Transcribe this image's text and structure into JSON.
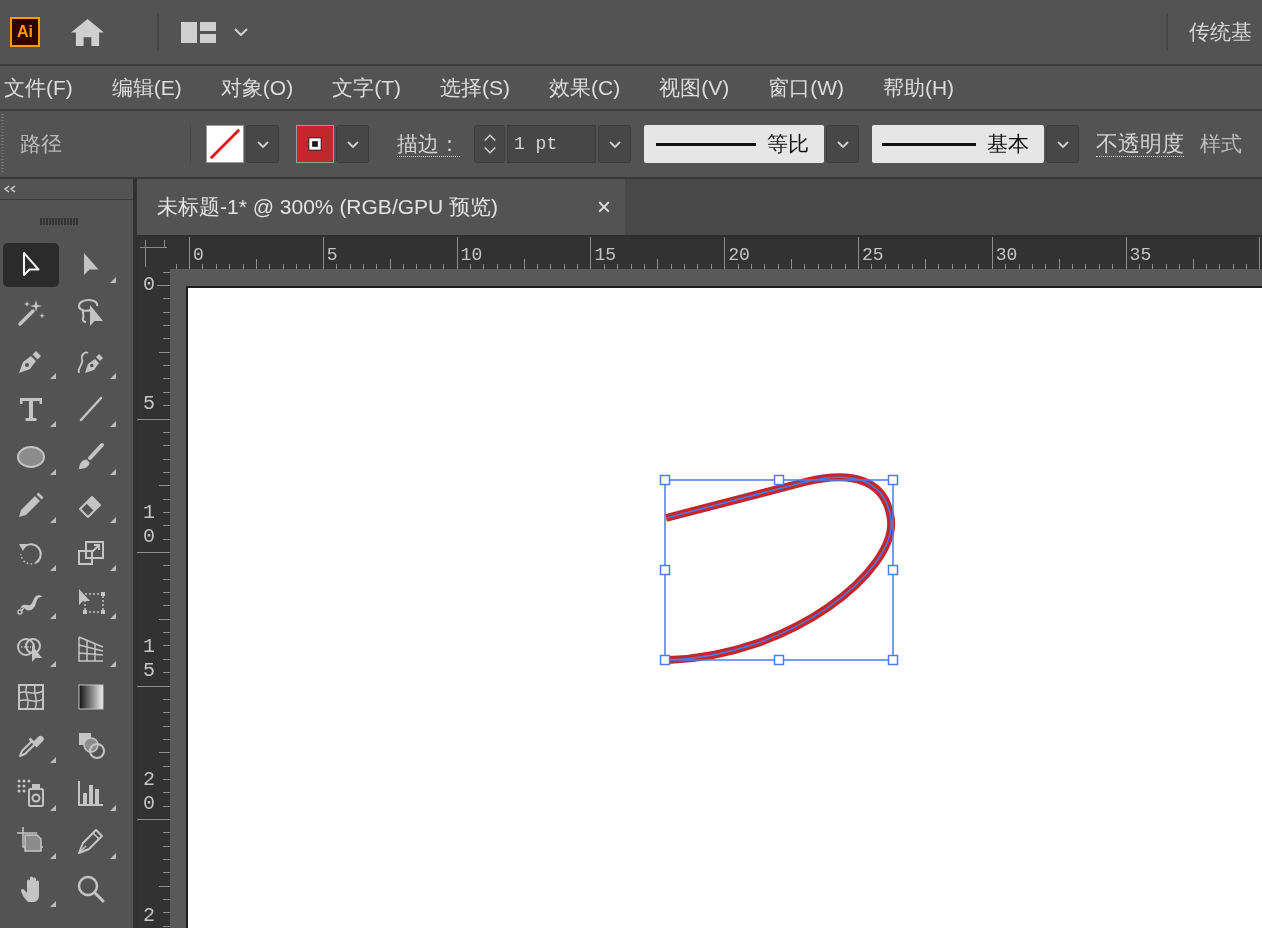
{
  "app_bar": {
    "logo": "Ai",
    "workspace": "传统基"
  },
  "menu_bar": {
    "items": [
      "文件(F)",
      "编辑(E)",
      "对象(O)",
      "文字(T)",
      "选择(S)",
      "效果(C)",
      "视图(V)",
      "窗口(W)",
      "帮助(H)"
    ]
  },
  "control_bar": {
    "selection": "路径",
    "fill_swatch": {
      "kind": "none"
    },
    "stroke_swatch": {
      "kind": "solid",
      "color": "#c1272d"
    },
    "stroke_label": "描边：",
    "stroke_weight": "1 pt",
    "width_profile": "等比",
    "brush": "基本",
    "opacity_label": "不透明度",
    "style_label": "样式"
  },
  "toolbar": {
    "tools": [
      {
        "kind": "selection",
        "selected": true,
        "flyout": false
      },
      {
        "kind": "direct_selection",
        "selected": false,
        "flyout": true
      },
      {
        "kind": "magic_wand",
        "selected": false,
        "flyout": false
      },
      {
        "kind": "lasso",
        "selected": false,
        "flyout": false
      },
      {
        "kind": "pen",
        "selected": false,
        "flyout": true
      },
      {
        "kind": "curvature",
        "selected": false,
        "flyout": true
      },
      {
        "kind": "type",
        "selected": false,
        "flyout": true
      },
      {
        "kind": "line",
        "selected": false,
        "flyout": true
      },
      {
        "kind": "ellipse",
        "selected": false,
        "flyout": true
      },
      {
        "kind": "paintbrush",
        "selected": false,
        "flyout": true
      },
      {
        "kind": "pencil",
        "selected": false,
        "flyout": true
      },
      {
        "kind": "eraser",
        "selected": false,
        "flyout": true
      },
      {
        "kind": "rotate",
        "selected": false,
        "flyout": true
      },
      {
        "kind": "scale",
        "selected": false,
        "flyout": true
      },
      {
        "kind": "width",
        "selected": false,
        "flyout": true
      },
      {
        "kind": "free_transform",
        "selected": false,
        "flyout": true
      },
      {
        "kind": "shape_builder",
        "selected": false,
        "flyout": true
      },
      {
        "kind": "perspective_grid",
        "selected": false,
        "flyout": true
      },
      {
        "kind": "mesh",
        "selected": false,
        "flyout": false
      },
      {
        "kind": "gradient",
        "selected": false,
        "flyout": false
      },
      {
        "kind": "eyedropper",
        "selected": false,
        "flyout": true
      },
      {
        "kind": "blend",
        "selected": false,
        "flyout": false
      },
      {
        "kind": "symbol_sprayer",
        "selected": false,
        "flyout": true
      },
      {
        "kind": "column_graph",
        "selected": false,
        "flyout": true
      },
      {
        "kind": "artboard",
        "selected": false,
        "flyout": true
      },
      {
        "kind": "slice",
        "selected": false,
        "flyout": true
      },
      {
        "kind": "hand",
        "selected": false,
        "flyout": true
      },
      {
        "kind": "zoom",
        "selected": false,
        "flyout": false
      }
    ]
  },
  "document": {
    "tab": {
      "title": "未标题-1* @ 300% (RGB/GPU 预览)",
      "close": "×",
      "selected": true
    },
    "horizontal_ruler": {
      "labels": [
        "0",
        "5",
        "10",
        "15",
        "20",
        "25",
        "30",
        "35"
      ]
    },
    "vertical_ruler": {
      "labels": [
        "0",
        "5",
        "10",
        "15",
        "20",
        "2"
      ]
    }
  }
}
